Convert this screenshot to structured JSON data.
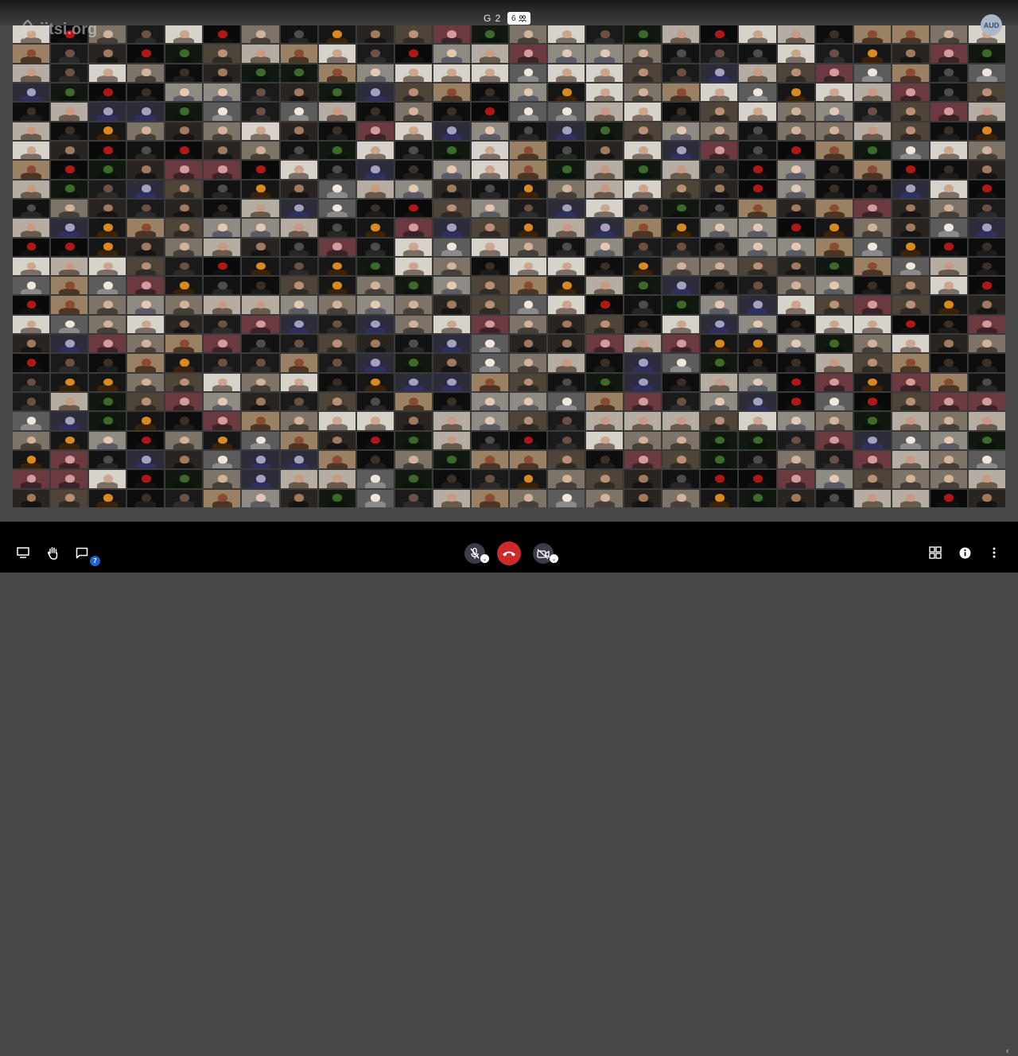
{
  "header": {
    "room_name": "G 2",
    "participant_count": "6",
    "logo_text": "jitsi.org",
    "avatar_initials": "AUD"
  },
  "icons": {
    "logo": "jitsi-logo-icon",
    "participants": "participants-icon",
    "screen_share": "screen-share-icon",
    "raise_hand": "raise-hand-icon",
    "chat": "chat-icon",
    "mic": "microphone-muted-icon",
    "hangup": "hangup-icon",
    "camera": "camera-off-icon",
    "tile_view": "tile-view-icon",
    "info": "info-icon",
    "more": "more-options-icon",
    "collapse": "chevron-left-icon"
  },
  "toolbar": {
    "chat_unread": "7"
  },
  "grid": {
    "columns": 26,
    "rows": 25
  },
  "colors": {
    "hangup": "#cf2a2a",
    "muted_bg": "#3d3d4a",
    "badge": "#1f62d4",
    "page_bg": "#474747"
  },
  "tile_palettes": [
    {
      "bg": "#0d0d0d",
      "head": "#3b3026",
      "torso": "#1c1c1c"
    },
    {
      "bg": "#7d7467",
      "head": "#d2b39a",
      "torso": "#463f38"
    },
    {
      "bg": "#b5aca2",
      "head": "#c99a83",
      "torso": "#6a5a4c"
    },
    {
      "bg": "#1a1a1a",
      "head": "#6a5142",
      "torso": "#2b2b2b"
    },
    {
      "bg": "#4f4438",
      "head": "#b99075",
      "torso": "#2f2a24"
    },
    {
      "bg": "#8f8a82",
      "head": "#e3c9b2",
      "torso": "#5b5b66"
    },
    {
      "bg": "#2a2420",
      "head": "#a07a5e",
      "torso": "#151515"
    },
    {
      "bg": "#d7d2ca",
      "head": "#cba58c",
      "torso": "#7d6e65"
    },
    {
      "bg": "#0a0a0a",
      "head": "#b01818",
      "torso": "#111111"
    },
    {
      "bg": "#161616",
      "head": "#d88a20",
      "torso": "#3a2208"
    },
    {
      "bg": "#101810",
      "head": "#3d6a2a",
      "torso": "#0b140b"
    },
    {
      "bg": "#2c2c3a",
      "head": "#a4a0c0",
      "torso": "#303060"
    },
    {
      "bg": "#6b3a40",
      "head": "#d59a9a",
      "torso": "#3a2226"
    },
    {
      "bg": "#5c5c5c",
      "head": "#efe7dc",
      "torso": "#8a8a8a"
    },
    {
      "bg": "#121212",
      "head": "#4d4d4d",
      "torso": "#262626"
    },
    {
      "bg": "#9a8164",
      "head": "#8a4a32",
      "torso": "#4d3424"
    }
  ]
}
